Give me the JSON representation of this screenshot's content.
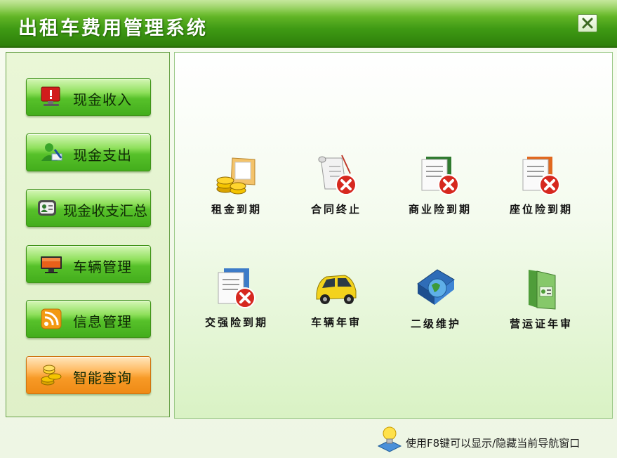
{
  "window": {
    "title": "出租车费用管理系统",
    "close_glyph": "✕"
  },
  "sidebar": {
    "items": [
      {
        "label": "现金收入",
        "icon": "monitor-alert-icon",
        "active": false
      },
      {
        "label": "现金支出",
        "icon": "user-pen-icon",
        "active": false
      },
      {
        "label": "现金收支汇总",
        "icon": "contact-card-icon",
        "active": false
      },
      {
        "label": "车辆管理",
        "icon": "monitor-icon",
        "active": false
      },
      {
        "label": "信息管理",
        "icon": "rss-icon",
        "active": false
      },
      {
        "label": "智能查询",
        "icon": "coins-icon",
        "active": true
      }
    ]
  },
  "main": {
    "tiles": [
      {
        "label": "租金到期",
        "icon": "coins-folder-icon"
      },
      {
        "label": "合同终止",
        "icon": "scroll-cancel-icon"
      },
      {
        "label": "商业险到期",
        "icon": "document-cancel-icon"
      },
      {
        "label": "座位险到期",
        "icon": "document-cancel-icon"
      },
      {
        "label": "交强险到期",
        "icon": "document-cancel-icon"
      },
      {
        "label": "车辆年审",
        "icon": "yellow-car-icon"
      },
      {
        "label": "二级维护",
        "icon": "globe-book-icon"
      },
      {
        "label": "营运证年审",
        "icon": "green-folder-icon"
      }
    ]
  },
  "status": {
    "hint": "使用F8键可以显示/隐藏当前导航窗口",
    "hint_icon": "lightbulb-icon"
  },
  "colors": {
    "title_bar": "#3f9a14",
    "nav_green": "#57c12a",
    "nav_active_orange": "#f79a26"
  }
}
